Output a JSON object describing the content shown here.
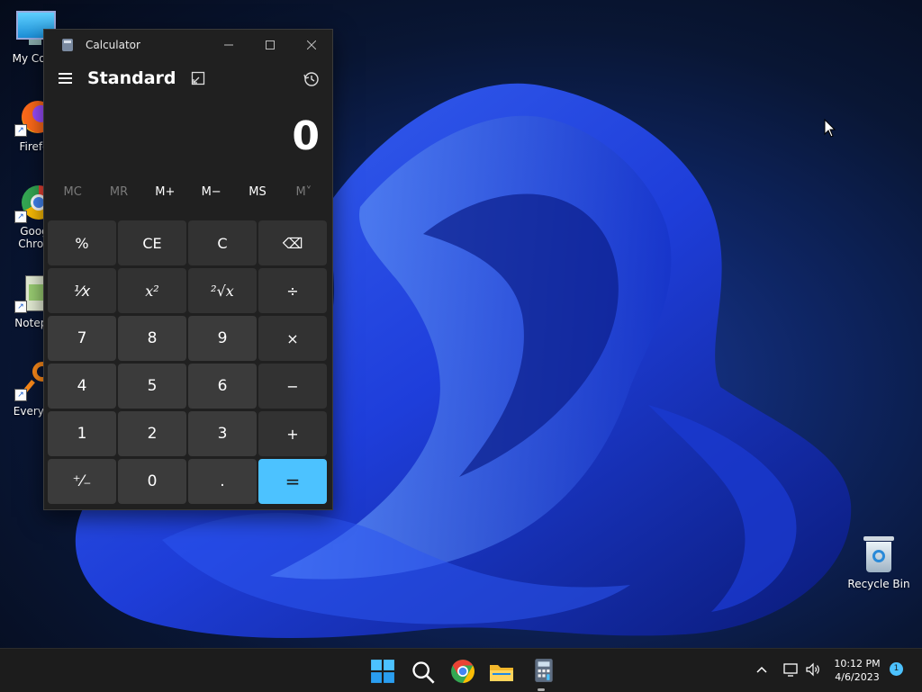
{
  "desktop": {
    "icons": [
      {
        "label": "My Com"
      },
      {
        "label": "Firefo"
      },
      {
        "label": "Goog"
      },
      {
        "label": "Chron"
      },
      {
        "label": "Notepa"
      },
      {
        "label": "Everyth"
      }
    ],
    "recycle_bin": {
      "label": "Recycle Bin"
    }
  },
  "calculator": {
    "title": "Calculator",
    "mode": "Standard",
    "display": "0",
    "memory": [
      "MC",
      "MR",
      "M+",
      "M−",
      "MS",
      "M˅"
    ],
    "keys": [
      [
        "%",
        "CE",
        "C",
        "⌫"
      ],
      [
        "¹⁄x",
        "x²",
        "²√x",
        "÷"
      ],
      [
        "7",
        "8",
        "9",
        "×"
      ],
      [
        "4",
        "5",
        "6",
        "−"
      ],
      [
        "1",
        "2",
        "3",
        "+"
      ],
      [
        "⁺⁄₋",
        "0",
        ".",
        "="
      ]
    ],
    "accent_color": "#4cc2ff"
  },
  "taskbar": {
    "time": "10:12 PM",
    "date": "4/6/2023",
    "notification_count": "1"
  }
}
